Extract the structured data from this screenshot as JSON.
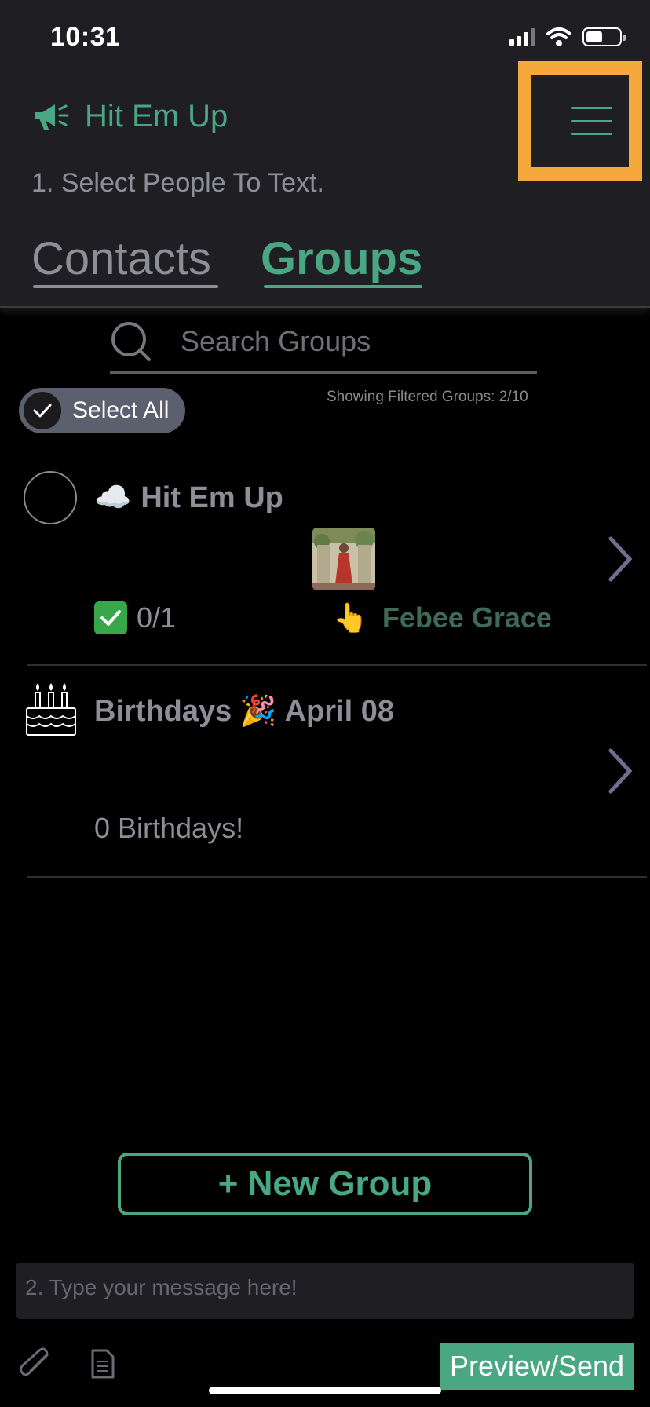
{
  "status": {
    "time": "10:31",
    "battery_level": 0.5
  },
  "header": {
    "app_title": "Hit Em Up",
    "step_instruction": "1. Select People To Text.",
    "tabs": [
      {
        "label": "Contacts",
        "active": false
      },
      {
        "label": "Groups",
        "active": true
      }
    ]
  },
  "search": {
    "placeholder": "Search Groups"
  },
  "select_all": {
    "label": "Select All"
  },
  "filter_info": "Showing Filtered Groups: 2/10",
  "groups": [
    {
      "emoji": "☁️",
      "title": "Hit Em Up",
      "count": "0/1",
      "member_emoji": "👆",
      "member_name": "Febee Grace"
    },
    {
      "title_prefix": "Birthdays",
      "emoji": "🎉",
      "title_suffix": "April 08",
      "count": "0 Birthdays!"
    }
  ],
  "new_group_button": "+ New Group",
  "message": {
    "placeholder": "2. Type your message here!"
  },
  "preview_button": "Preview/Send",
  "colors": {
    "accent": "#4aa784",
    "highlight": "#f5a93c",
    "header_bg": "#1f1f23"
  }
}
